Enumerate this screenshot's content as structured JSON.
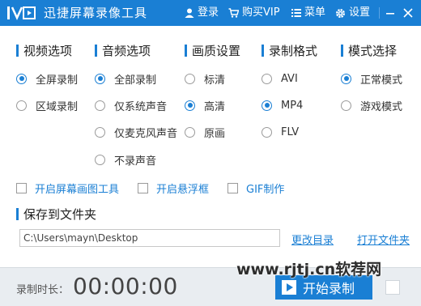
{
  "app": {
    "title": "迅捷屏幕录像工具",
    "accent": "#1a7fd4"
  },
  "titlebar": {
    "login": "登录",
    "buy_vip": "购买VIP",
    "menu": "菜单",
    "settings": "设置"
  },
  "columns": [
    {
      "title": "视频选项",
      "options": [
        {
          "label": "全屏录制",
          "selected": true
        },
        {
          "label": "区域录制",
          "selected": false
        }
      ]
    },
    {
      "title": "音频选项",
      "options": [
        {
          "label": "全部录制",
          "selected": true
        },
        {
          "label": "仅系统声音",
          "selected": false
        },
        {
          "label": "仅麦克风声音",
          "selected": false
        },
        {
          "label": "不录声音",
          "selected": false
        }
      ]
    },
    {
      "title": "画质设置",
      "options": [
        {
          "label": "标清",
          "selected": false
        },
        {
          "label": "高清",
          "selected": true
        },
        {
          "label": "原画",
          "selected": false
        }
      ]
    },
    {
      "title": "录制格式",
      "options": [
        {
          "label": "AVI",
          "selected": false
        },
        {
          "label": "MP4",
          "selected": true
        },
        {
          "label": "FLV",
          "selected": false
        }
      ]
    },
    {
      "title": "模式选择",
      "options": [
        {
          "label": "正常模式",
          "selected": true
        },
        {
          "label": "游戏模式",
          "selected": false
        }
      ]
    }
  ],
  "tools": {
    "screen_draw": "开启屏幕画图工具",
    "floating_frame": "开启悬浮框",
    "gif": "GIF制作"
  },
  "save": {
    "title": "保存到文件夹",
    "path": "C:\\Users\\mayn\\Desktop",
    "change_dir": "更改目录",
    "open_folder": "打开文件夹"
  },
  "footer": {
    "duration_label": "录制时长：",
    "duration_value": "00:00:00",
    "start_label": "开始录制"
  },
  "watermark": "www.rjtj.cn软荐网"
}
